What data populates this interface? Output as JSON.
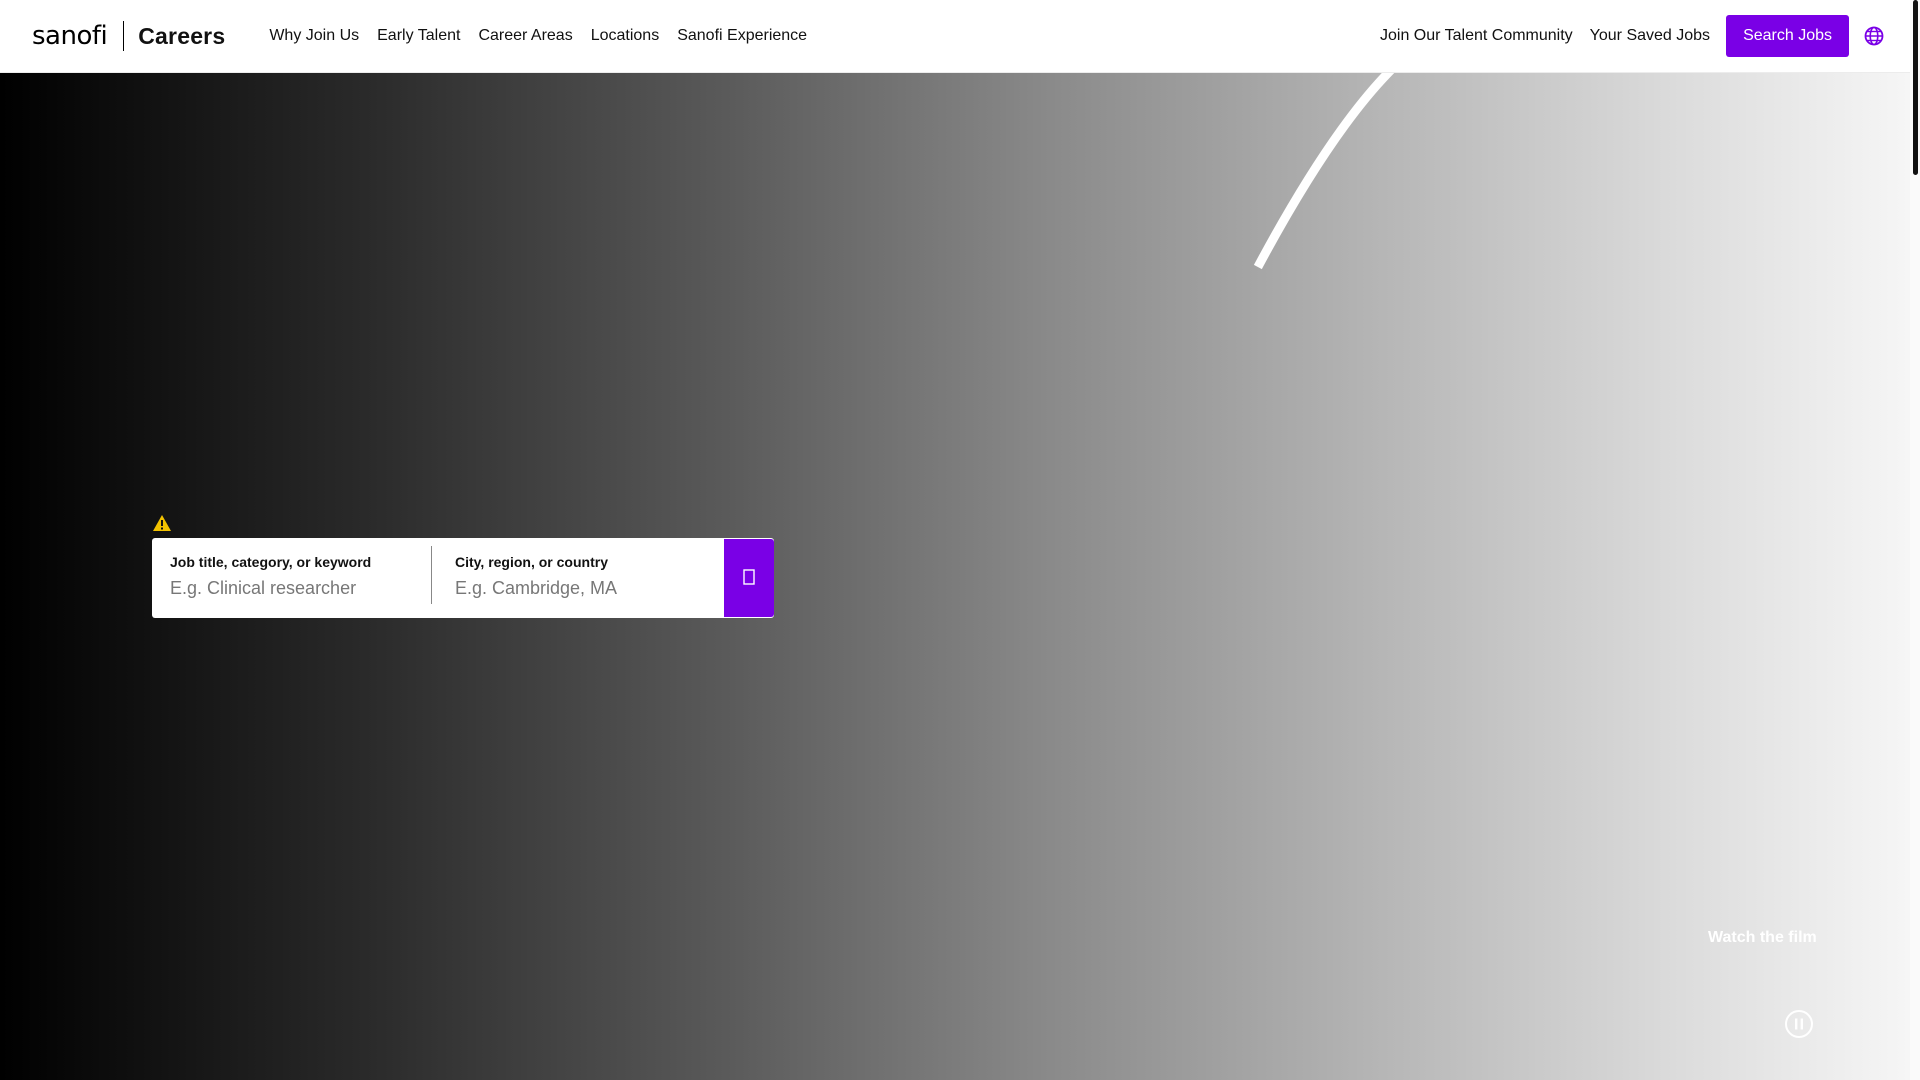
{
  "header": {
    "logo_text": "sanofi",
    "section_title": "Careers",
    "nav_items": [
      {
        "label": "Why Join Us"
      },
      {
        "label": "Early Talent"
      },
      {
        "label": "Career Areas"
      },
      {
        "label": "Locations"
      },
      {
        "label": "Sanofi Experience"
      }
    ],
    "talent_community_label": "Join Our Talent Community",
    "saved_jobs_label": "Your Saved Jobs",
    "search_jobs_label": "Search Jobs",
    "language_icon": "globe-icon"
  },
  "search": {
    "warning_icon": "warning-icon",
    "keyword": {
      "label": "Job title, category, or keyword",
      "value": "",
      "placeholder": "E.g. Clinical researcher"
    },
    "location": {
      "label": "City, region, or country",
      "value": "",
      "placeholder": "E.g. Cambridge, MA"
    },
    "submit_icon": "search-icon"
  },
  "hero": {
    "watch_film_label": "Watch the film",
    "pause_icon": "pause-icon"
  },
  "colors": {
    "accent": "#7a00e6",
    "warning": "#f2c200"
  }
}
